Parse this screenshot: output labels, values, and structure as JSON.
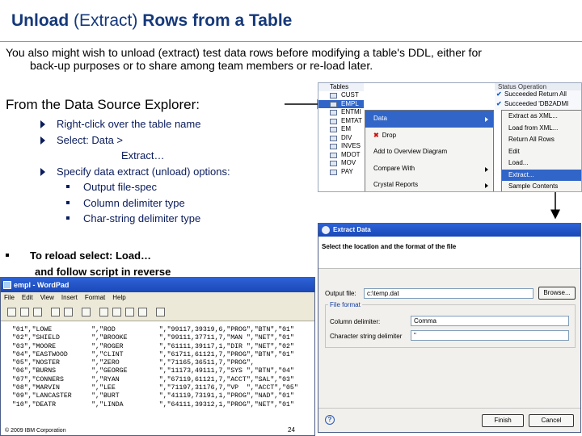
{
  "slide": {
    "title_bold_1": "Unload",
    "title_normal": " (Extract) ",
    "title_bold_2": "Rows from a Table",
    "intro_line1": "You also might wish to unload (extract) test data rows before modifying a table's DDL, either for",
    "intro_line2": "back-up purposes or to share among team members or re-load later.",
    "section_heading": "From the Data Source Explorer:",
    "bullets": [
      {
        "label": "Right-click over the table name"
      },
      {
        "label": "Select: Data   >"
      }
    ],
    "bullet2_continuation": "Extract…",
    "bullet3": "Specify data extract (unload) options:",
    "sub_bullets": [
      "Output file-spec",
      "Column delimiter type",
      "Char-string delimiter type"
    ],
    "reload_line1": "To reload select: Load…",
    "reload_line2": "and follow script in reverse",
    "copyright": "© 2009 IBM Corporation",
    "page_number": "24"
  },
  "explorer": {
    "tables_header": "Tables",
    "tables": [
      "CUST",
      "EMPL",
      "ENTMI",
      "EMTAT",
      "EM",
      "DIV",
      "INVES",
      "MDOT",
      "MOV",
      "PAY"
    ],
    "selected_table_index": 1,
    "status_header": "Status          Operation",
    "status_rows": [
      "Succeeded  Return All",
      "Succeeded  'DB2ADMI"
    ],
    "context_menu": [
      {
        "label": "Data",
        "submenu": true,
        "selected": true
      },
      {
        "label": "Drop",
        "submenu": false,
        "selected": false
      },
      {
        "label": "Add to Overview Diagram",
        "submenu": false,
        "selected": false
      },
      {
        "label": "Compare With",
        "submenu": true,
        "selected": false
      },
      {
        "label": "Crystal Reports",
        "submenu": true,
        "selected": false
      }
    ],
    "data_submenu": [
      {
        "label": "Extract as XML...",
        "selected": false
      },
      {
        "label": "Load from XML...",
        "selected": false
      },
      {
        "label": "Return All Rows",
        "selected": false
      },
      {
        "label": "Edit",
        "selected": false
      },
      {
        "label": "Load...",
        "selected": false
      },
      {
        "label": "Extract...",
        "selected": true
      },
      {
        "label": "Sample Contents",
        "selected": false
      }
    ]
  },
  "dialog": {
    "title": "Extract Data",
    "lead": "Select the location and the format of the file",
    "output_file_label": "Output file:",
    "output_file_value": "c:\\temp.dat",
    "browse_label": "Browse...",
    "group_label": "File format",
    "column_delimiter_label": "Column delimiter:",
    "column_delimiter_value": "Comma",
    "char_delimiter_label": "Character string delimiter",
    "char_delimiter_value": "\"",
    "finish_label": "Finish",
    "cancel_label": "Cancel",
    "help_glyph": "?"
  },
  "wordpad": {
    "title": "empl - WordPad",
    "menus": [
      "File",
      "Edit",
      "View",
      "Insert",
      "Format",
      "Help"
    ],
    "lines": [
      "\"01\",\"LOWE          \",\"ROD           \",\"99117,39319,6,\"PROG\",\"BTN\",\"01\"",
      "\"02\",\"SHIELD        \",\"BROOKE        \",\"99111,37711,7,\"MAN \",\"NET\",\"01\"",
      "\"03\",\"MOORE         \",\"ROGER         \",\"61111,39117,1,\"DIR \",\"NET\",\"02\"",
      "\"04\",\"EASTWOOD      \",\"CLINT         \",\"61711,61121,7,\"PROG\",\"BTN\",\"01\"",
      "\"05\",\"NOSTER        \",\"ZERO          \",\"71165,36511,7,\"PROG\",",
      "\"06\",\"BURNS         \",\"GEORGE        \",\"11173,49111,7,\"SYS \",\"BTN\",\"04\"",
      "\"07\",\"CONNERS       \",\"RYAN          \",\"67119,61121,7,\"ACCT\",\"SAL\",\"03\"",
      "\"08\",\"MARVIN        \",\"LEE           \",\"71197,31176,7,\"VP  \",\"ACCT\",\"05\"",
      "\"09\",\"LANCASTER     \",\"BURT          \",\"41119,73191,1,\"PROG\",\"NAD\",\"01\"",
      "\"10\",\"DEATR         \",\"LINDA         \",\"64111,39312,1,\"PROG\",\"NET\",\"01\""
    ]
  }
}
